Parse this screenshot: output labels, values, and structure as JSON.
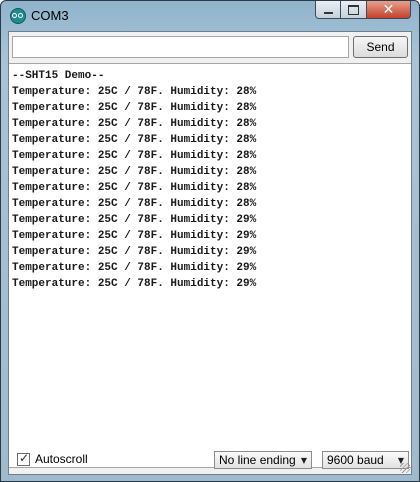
{
  "window": {
    "title": "COM3"
  },
  "send": {
    "input_value": "",
    "button_label": "Send"
  },
  "serial_output": {
    "lines": [
      "--SHT15 Demo--",
      "Temperature: 25C / 78F. Humidity: 28%",
      "Temperature: 25C / 78F. Humidity: 28%",
      "Temperature: 25C / 78F. Humidity: 28%",
      "Temperature: 25C / 78F. Humidity: 28%",
      "Temperature: 25C / 78F. Humidity: 28%",
      "Temperature: 25C / 78F. Humidity: 28%",
      "Temperature: 25C / 78F. Humidity: 28%",
      "Temperature: 25C / 78F. Humidity: 28%",
      "Temperature: 25C / 78F. Humidity: 29%",
      "Temperature: 25C / 78F. Humidity: 29%",
      "Temperature: 25C / 78F. Humidity: 29%",
      "Temperature: 25C / 78F. Humidity: 29%",
      "Temperature: 25C / 78F. Humidity: 29%"
    ]
  },
  "footer": {
    "autoscroll_label": "Autoscroll",
    "autoscroll_checked": true,
    "line_ending": "No line ending",
    "baud_rate": "9600 baud"
  },
  "icons": {
    "app": "arduino-icon",
    "minimize": "minimize-icon",
    "maximize": "maximize-icon",
    "close": "close-icon",
    "dropdown": "chevron-down-icon"
  },
  "colors": {
    "close_button": "#c3412b",
    "app_icon": "#1d8d8f",
    "title_bar": "#9dbcd2"
  }
}
